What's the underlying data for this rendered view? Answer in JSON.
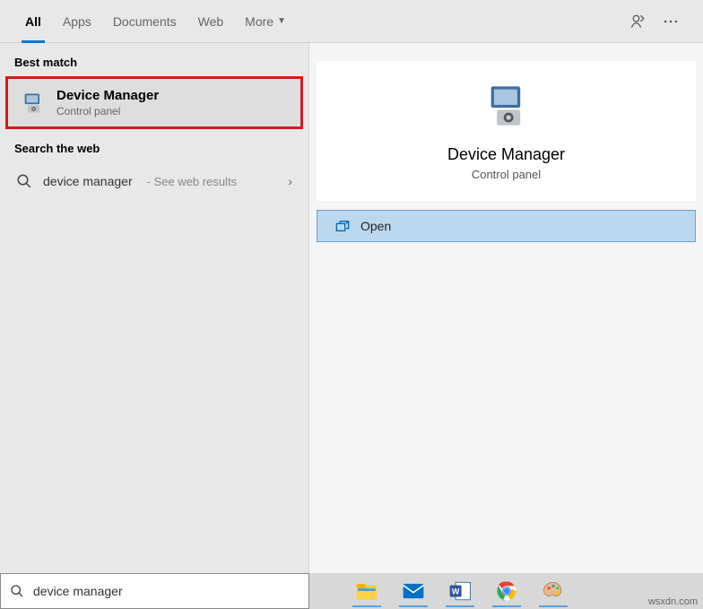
{
  "tabs": {
    "all": "All",
    "apps": "Apps",
    "documents": "Documents",
    "web": "Web",
    "more": "More"
  },
  "sections": {
    "best_match": "Best match",
    "search_web": "Search the web"
  },
  "best_match": {
    "title": "Device Manager",
    "subtitle": "Control panel"
  },
  "web": {
    "query": "device manager",
    "hint": "- See web results"
  },
  "preview": {
    "title": "Device Manager",
    "subtitle": "Control panel",
    "open": "Open"
  },
  "search": {
    "value": "device manager"
  },
  "watermark": "wsxdn.com"
}
